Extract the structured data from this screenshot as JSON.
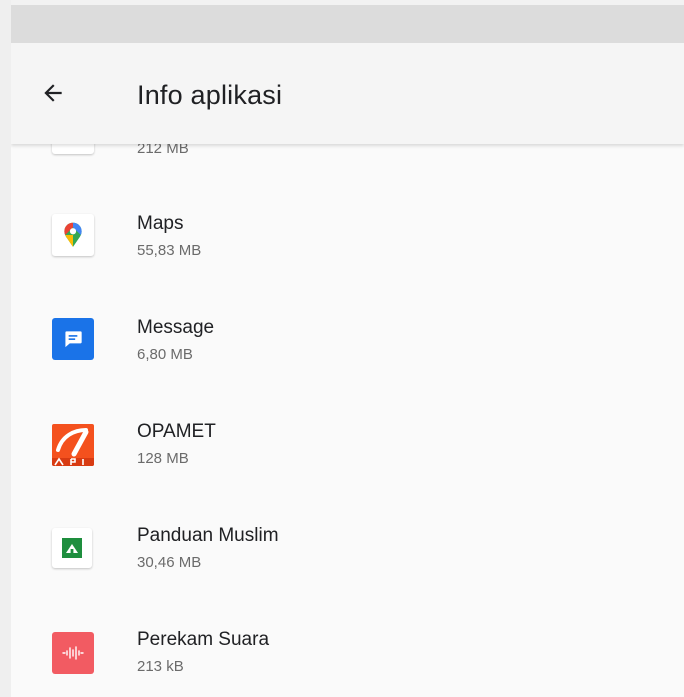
{
  "header": {
    "title": "Info aplikasi",
    "back_icon": "arrow-back-icon"
  },
  "apps": [
    {
      "name": "",
      "size": "212 MB",
      "icon": "app-icon"
    },
    {
      "name": "Maps",
      "size": "55,83 MB",
      "icon": "maps-pin-icon"
    },
    {
      "name": "Message",
      "size": "6,80 MB",
      "icon": "message-bubble-icon"
    },
    {
      "name": "OPAMET",
      "size": "128 MB",
      "icon": "opamet-logo-icon"
    },
    {
      "name": "Panduan Muslim",
      "size": "30,46 MB",
      "icon": "mosque-icon"
    },
    {
      "name": "Perekam Suara",
      "size": "213 kB",
      "icon": "voice-wave-icon"
    }
  ],
  "colors": {
    "maps_red": "#ea4335",
    "maps_yellow": "#fbbc04",
    "maps_green": "#34a853",
    "maps_blue": "#4285f4",
    "message_blue": "#1a73e8",
    "opamet_red": "#f4511e",
    "panduan_green": "#1e8e3e",
    "perekam_red": "#f25b62"
  }
}
